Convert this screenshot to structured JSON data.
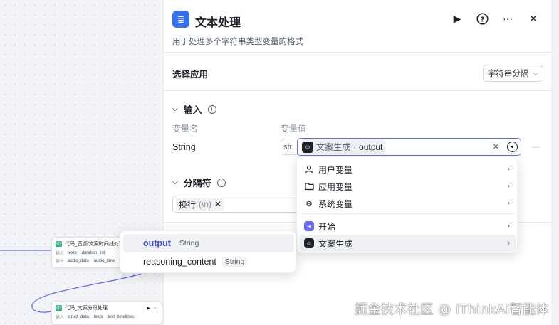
{
  "panel": {
    "title": "文本处理",
    "description": "用于处理多个字符串类型变量的格式"
  },
  "select_app": {
    "label": "选择应用",
    "selected": "字符串分隔"
  },
  "input_section": {
    "title": "输入",
    "col_name": "变量名",
    "col_value": "变量值",
    "row": {
      "name": "String",
      "type": "str.",
      "ref_source": "文案生成",
      "ref_sep": "·",
      "ref_field": "output"
    }
  },
  "separator_section": {
    "title": "分隔符",
    "chip_label": "换行",
    "chip_escape": "(\\n)"
  },
  "menu": {
    "items": [
      {
        "label": "用户变量",
        "icon": "user-icon"
      },
      {
        "label": "应用变量",
        "icon": "folder-icon"
      },
      {
        "label": "系统变量",
        "icon": "gear-icon"
      },
      {
        "label": "开始",
        "icon": "start-icon"
      },
      {
        "label": "文案生成",
        "icon": "bot-icon"
      }
    ]
  },
  "submenu": {
    "items": [
      {
        "name": "output",
        "type": "String"
      },
      {
        "name": "reasoning_content",
        "type": "String"
      }
    ]
  },
  "canvas_nodes": [
    {
      "title": "代码_音频/文案时间线处理",
      "row1_label": "输入",
      "row1_a": "texts",
      "row1_b": "duration_list",
      "row2_label": "输出",
      "row2_a": "audio_data",
      "row2_b": "audio_time"
    },
    {
      "title": "代码_文案分段处理",
      "row1_label": "输入",
      "row1_a": "struct_data",
      "row1_b": "texts",
      "row1_c": "text_timelines"
    }
  ],
  "watermark": "掘金技术社区 @ iThinkAi智能体"
}
